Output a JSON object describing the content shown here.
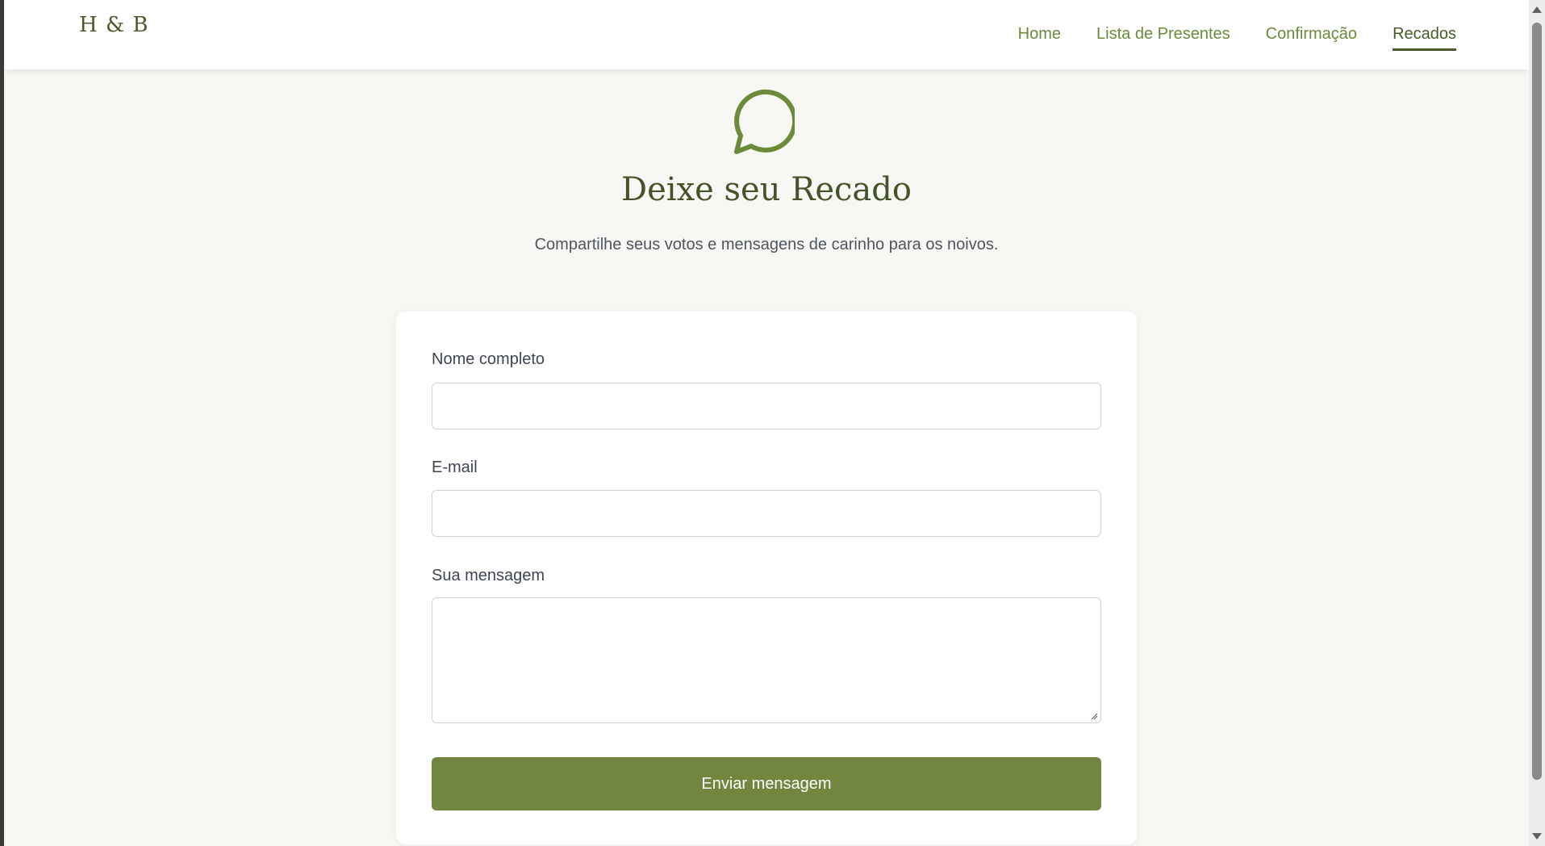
{
  "header": {
    "logo": "H & B",
    "nav": [
      {
        "label": "Home",
        "active": false
      },
      {
        "label": "Lista de Presentes",
        "active": false
      },
      {
        "label": "Confirmação",
        "active": false
      },
      {
        "label": "Recados",
        "active": true
      }
    ]
  },
  "hero": {
    "icon": "chat-bubble-icon",
    "title": "Deixe seu Recado",
    "subtitle": "Compartilhe seus votos e mensagens de carinho para os noivos."
  },
  "form": {
    "name_label": "Nome completo",
    "name_value": "",
    "email_label": "E-mail",
    "email_value": "",
    "message_label": "Sua mensagem",
    "message_value": "",
    "submit_label": "Enviar mensagem"
  },
  "colors": {
    "accent": "#738640",
    "heading": "#46532a",
    "nav_link": "#6b8a3a",
    "background": "#f7f7f3"
  }
}
